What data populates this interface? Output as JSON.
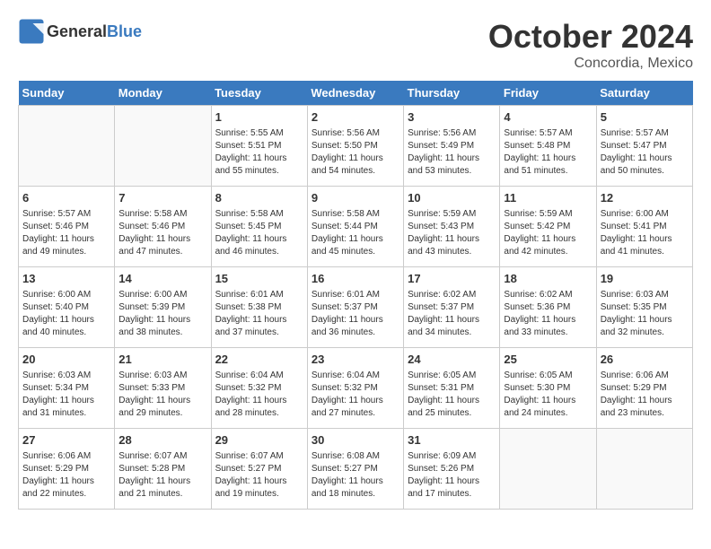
{
  "header": {
    "logo": "GeneralBlue",
    "month": "October 2024",
    "location": "Concordia, Mexico"
  },
  "weekdays": [
    "Sunday",
    "Monday",
    "Tuesday",
    "Wednesday",
    "Thursday",
    "Friday",
    "Saturday"
  ],
  "weeks": [
    [
      {
        "day": "",
        "info": ""
      },
      {
        "day": "",
        "info": ""
      },
      {
        "day": "1",
        "info": "Sunrise: 5:55 AM\nSunset: 5:51 PM\nDaylight: 11 hours and 55 minutes."
      },
      {
        "day": "2",
        "info": "Sunrise: 5:56 AM\nSunset: 5:50 PM\nDaylight: 11 hours and 54 minutes."
      },
      {
        "day": "3",
        "info": "Sunrise: 5:56 AM\nSunset: 5:49 PM\nDaylight: 11 hours and 53 minutes."
      },
      {
        "day": "4",
        "info": "Sunrise: 5:57 AM\nSunset: 5:48 PM\nDaylight: 11 hours and 51 minutes."
      },
      {
        "day": "5",
        "info": "Sunrise: 5:57 AM\nSunset: 5:47 PM\nDaylight: 11 hours and 50 minutes."
      }
    ],
    [
      {
        "day": "6",
        "info": "Sunrise: 5:57 AM\nSunset: 5:46 PM\nDaylight: 11 hours and 49 minutes."
      },
      {
        "day": "7",
        "info": "Sunrise: 5:58 AM\nSunset: 5:46 PM\nDaylight: 11 hours and 47 minutes."
      },
      {
        "day": "8",
        "info": "Sunrise: 5:58 AM\nSunset: 5:45 PM\nDaylight: 11 hours and 46 minutes."
      },
      {
        "day": "9",
        "info": "Sunrise: 5:58 AM\nSunset: 5:44 PM\nDaylight: 11 hours and 45 minutes."
      },
      {
        "day": "10",
        "info": "Sunrise: 5:59 AM\nSunset: 5:43 PM\nDaylight: 11 hours and 43 minutes."
      },
      {
        "day": "11",
        "info": "Sunrise: 5:59 AM\nSunset: 5:42 PM\nDaylight: 11 hours and 42 minutes."
      },
      {
        "day": "12",
        "info": "Sunrise: 6:00 AM\nSunset: 5:41 PM\nDaylight: 11 hours and 41 minutes."
      }
    ],
    [
      {
        "day": "13",
        "info": "Sunrise: 6:00 AM\nSunset: 5:40 PM\nDaylight: 11 hours and 40 minutes."
      },
      {
        "day": "14",
        "info": "Sunrise: 6:00 AM\nSunset: 5:39 PM\nDaylight: 11 hours and 38 minutes."
      },
      {
        "day": "15",
        "info": "Sunrise: 6:01 AM\nSunset: 5:38 PM\nDaylight: 11 hours and 37 minutes."
      },
      {
        "day": "16",
        "info": "Sunrise: 6:01 AM\nSunset: 5:37 PM\nDaylight: 11 hours and 36 minutes."
      },
      {
        "day": "17",
        "info": "Sunrise: 6:02 AM\nSunset: 5:37 PM\nDaylight: 11 hours and 34 minutes."
      },
      {
        "day": "18",
        "info": "Sunrise: 6:02 AM\nSunset: 5:36 PM\nDaylight: 11 hours and 33 minutes."
      },
      {
        "day": "19",
        "info": "Sunrise: 6:03 AM\nSunset: 5:35 PM\nDaylight: 11 hours and 32 minutes."
      }
    ],
    [
      {
        "day": "20",
        "info": "Sunrise: 6:03 AM\nSunset: 5:34 PM\nDaylight: 11 hours and 31 minutes."
      },
      {
        "day": "21",
        "info": "Sunrise: 6:03 AM\nSunset: 5:33 PM\nDaylight: 11 hours and 29 minutes."
      },
      {
        "day": "22",
        "info": "Sunrise: 6:04 AM\nSunset: 5:32 PM\nDaylight: 11 hours and 28 minutes."
      },
      {
        "day": "23",
        "info": "Sunrise: 6:04 AM\nSunset: 5:32 PM\nDaylight: 11 hours and 27 minutes."
      },
      {
        "day": "24",
        "info": "Sunrise: 6:05 AM\nSunset: 5:31 PM\nDaylight: 11 hours and 25 minutes."
      },
      {
        "day": "25",
        "info": "Sunrise: 6:05 AM\nSunset: 5:30 PM\nDaylight: 11 hours and 24 minutes."
      },
      {
        "day": "26",
        "info": "Sunrise: 6:06 AM\nSunset: 5:29 PM\nDaylight: 11 hours and 23 minutes."
      }
    ],
    [
      {
        "day": "27",
        "info": "Sunrise: 6:06 AM\nSunset: 5:29 PM\nDaylight: 11 hours and 22 minutes."
      },
      {
        "day": "28",
        "info": "Sunrise: 6:07 AM\nSunset: 5:28 PM\nDaylight: 11 hours and 21 minutes."
      },
      {
        "day": "29",
        "info": "Sunrise: 6:07 AM\nSunset: 5:27 PM\nDaylight: 11 hours and 19 minutes."
      },
      {
        "day": "30",
        "info": "Sunrise: 6:08 AM\nSunset: 5:27 PM\nDaylight: 11 hours and 18 minutes."
      },
      {
        "day": "31",
        "info": "Sunrise: 6:09 AM\nSunset: 5:26 PM\nDaylight: 11 hours and 17 minutes."
      },
      {
        "day": "",
        "info": ""
      },
      {
        "day": "",
        "info": ""
      }
    ]
  ]
}
